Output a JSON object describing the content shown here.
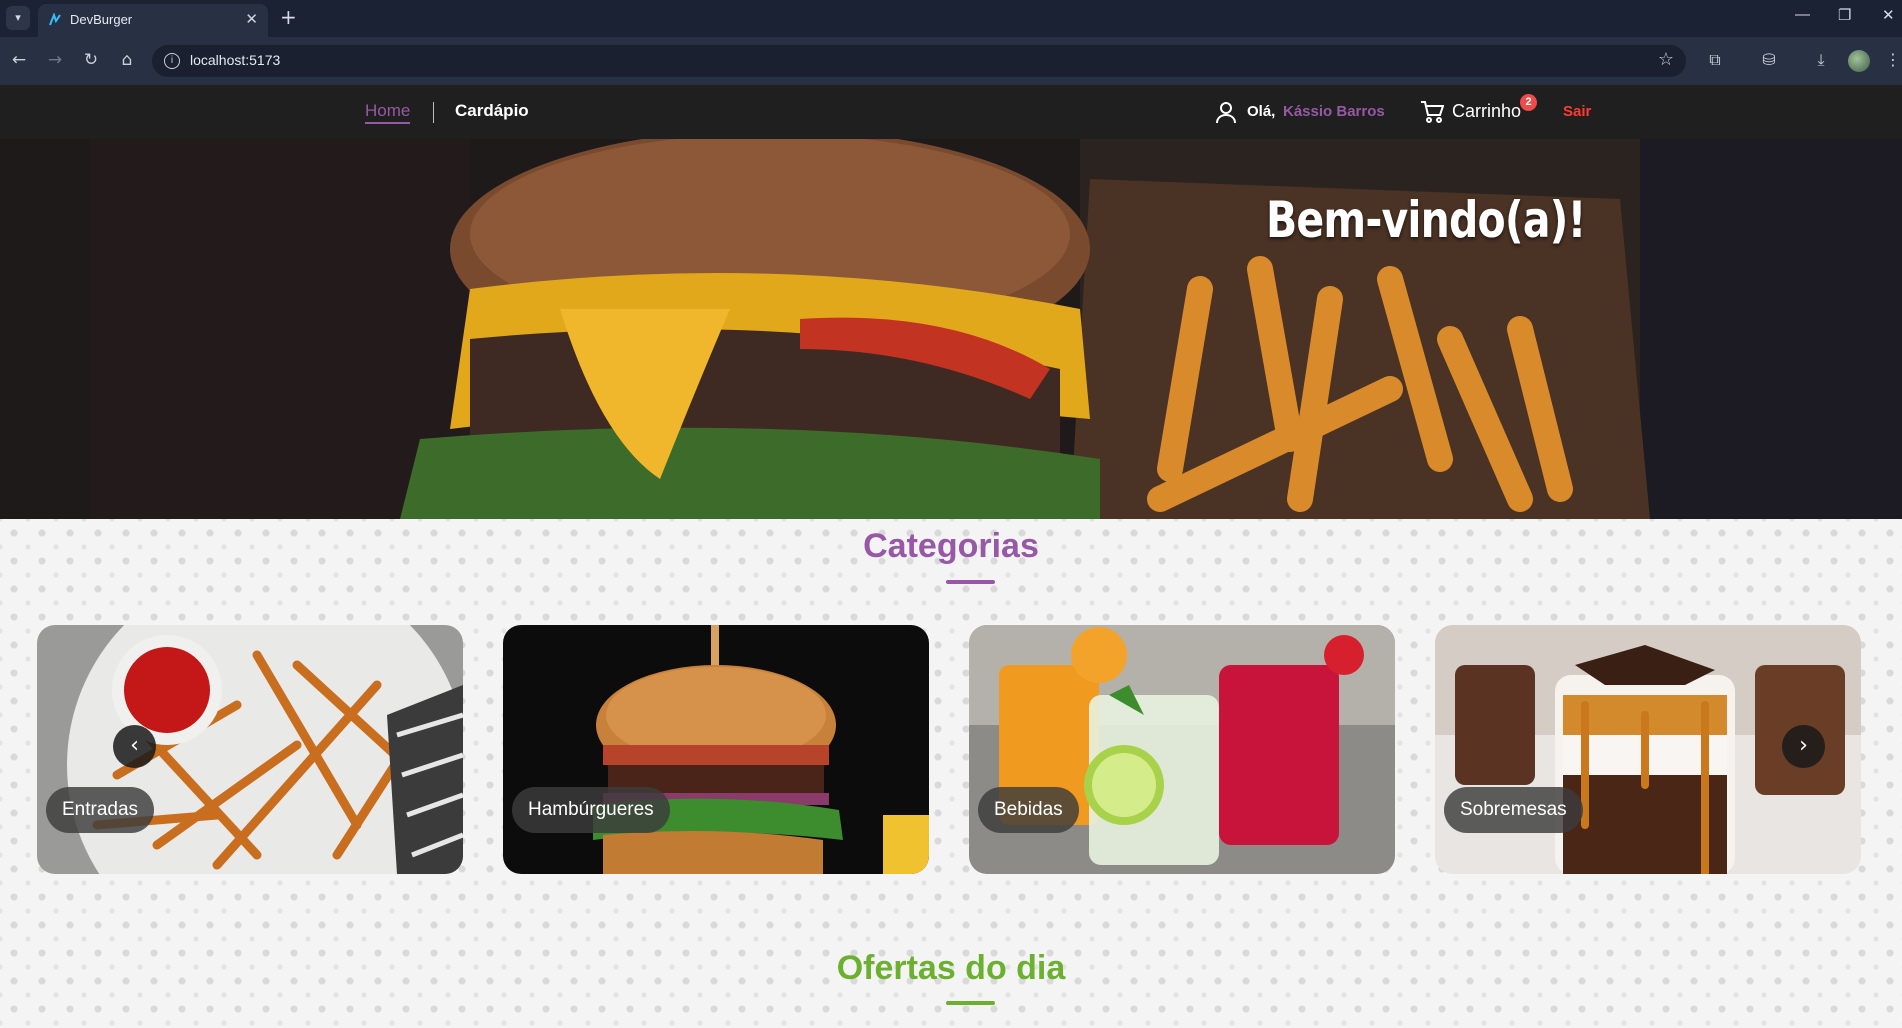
{
  "browser": {
    "tab_title": "DevBurger",
    "tab_close": "✕",
    "new_tab": "+",
    "url": "localhost:5173",
    "window_controls": [
      "—",
      "❐",
      "✕"
    ],
    "icons": [
      "back-arrow-icon",
      "forward-arrow-icon",
      "reload-icon",
      "home-icon",
      "bookmark-star-icon",
      "extensions-icon",
      "sidebar-icon",
      "download-icon",
      "profile-avatar-icon",
      "more-menu-icon"
    ]
  },
  "header": {
    "nav": {
      "home": "Home",
      "menu": "Cardápio"
    },
    "greeting": "Olá,",
    "username": "Kássio Barros",
    "cart_label": "Carrinho",
    "cart_count": "2",
    "logout": "Sair",
    "colors": {
      "accent": "#9758a6",
      "logout": "#ff3b30",
      "badge": "#ef4b4b",
      "bar": "#1f1f1f"
    }
  },
  "hero": {
    "title": "Bem-vindo(a)!"
  },
  "categories": {
    "title": "Categorias",
    "items": [
      {
        "label": "Entradas",
        "image": "fries-with-ketchup"
      },
      {
        "label": "Hambúrgueres",
        "image": "burger"
      },
      {
        "label": "Bebidas",
        "image": "drinks"
      },
      {
        "label": "Sobremesas",
        "image": "dessert-cups"
      }
    ],
    "prev_arrow": "‹",
    "next_arrow": "›"
  },
  "offers": {
    "title": "Ofertas do dia",
    "color": "#6bb02e"
  }
}
